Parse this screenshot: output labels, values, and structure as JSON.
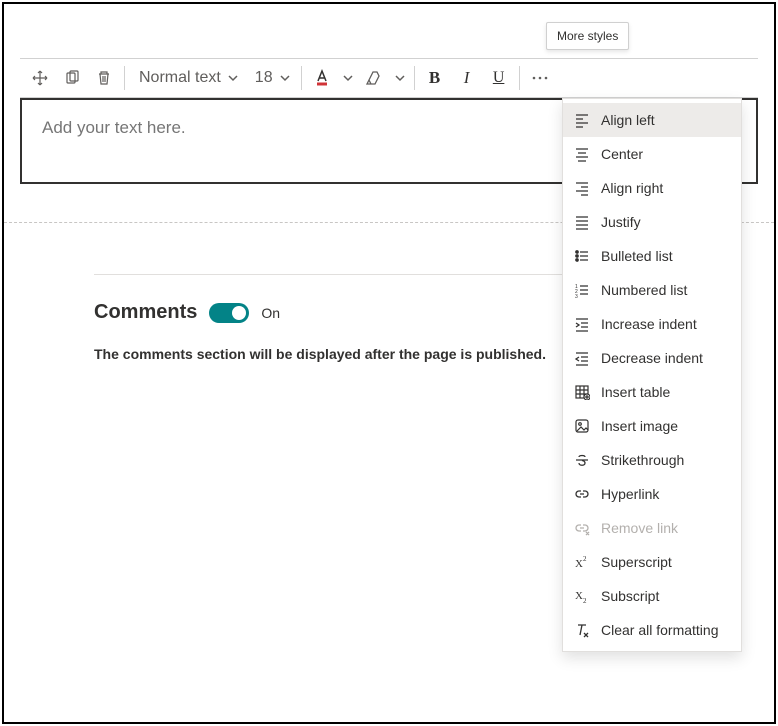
{
  "tooltip": {
    "more_styles": "More styles"
  },
  "toolbar": {
    "style_dropdown": "Normal text",
    "font_size": "18"
  },
  "editor": {
    "placeholder": "Add your text here."
  },
  "comments": {
    "title": "Comments",
    "toggle_state": "On",
    "note": "The comments section will be displayed after the page is published."
  },
  "menu": {
    "items": [
      "Align left",
      "Center",
      "Align right",
      "Justify",
      "Bulleted list",
      "Numbered list",
      "Increase indent",
      "Decrease indent",
      "Insert table",
      "Insert image",
      "Strikethrough",
      "Hyperlink",
      "Remove link",
      "Superscript",
      "Subscript",
      "Clear all formatting"
    ]
  }
}
